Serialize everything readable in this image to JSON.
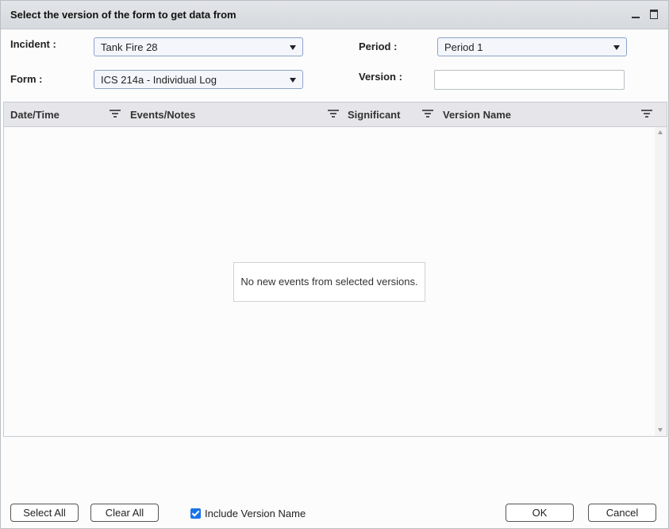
{
  "dialog": {
    "title": "Select the version of the form to get data from"
  },
  "fields": {
    "incident_label": "Incident :",
    "incident_value": "Tank Fire 28",
    "period_label": "Period :",
    "period_value": "Period 1",
    "form_label": "Form :",
    "form_value": "ICS 214a - Individual Log",
    "version_label": "Version :",
    "version_value": ""
  },
  "grid": {
    "columns": [
      "Date/Time",
      "Events/Notes",
      "Significant",
      "Version Name"
    ],
    "rows": [],
    "empty_message": "No new events from selected versions."
  },
  "footer": {
    "select_all": "Select All",
    "clear_all": "Clear All",
    "include_version_name": "Include Version Name",
    "include_version_name_checked": true,
    "ok": "OK",
    "cancel": "Cancel"
  },
  "icons": [
    "minimize-icon",
    "maximize-icon",
    "dropdown-arrow-icon",
    "filter-icon",
    "scroll-up-icon",
    "scroll-down-icon",
    "checkbox-checked-icon"
  ],
  "colors": {
    "titlebar": "#dcdfe3",
    "header": "#e6e6ea",
    "dropdown_border": "#8fa3c7",
    "checkbox": "#1a73e8"
  }
}
